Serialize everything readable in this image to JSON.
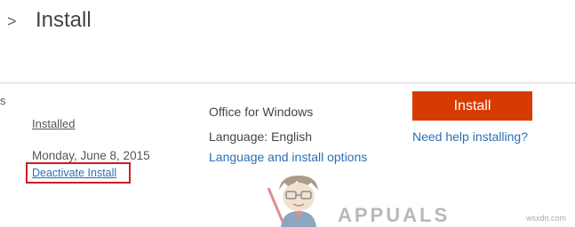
{
  "header": {
    "chevron": ">",
    "title": "Install"
  },
  "left_panel": {
    "edge_fragment": "s",
    "status_link": "Installed",
    "date": "Monday, June 8, 2015",
    "deactivate_link": "Deactivate Install"
  },
  "product": {
    "name": "Office for Windows",
    "language_line": "Language: English",
    "options_link": "Language and install options"
  },
  "install": {
    "button_label": "Install",
    "help_link": "Need help installing?"
  },
  "watermark": {
    "logo_text": "APPUALS",
    "site": "wsxdn.com"
  },
  "colors": {
    "install_button": "#d83b01",
    "link": "#2a6fb5",
    "highlight_box": "#cc1f1f"
  },
  "icons": [
    "chevron-right-icon",
    "appuals-mascot-icon"
  ]
}
